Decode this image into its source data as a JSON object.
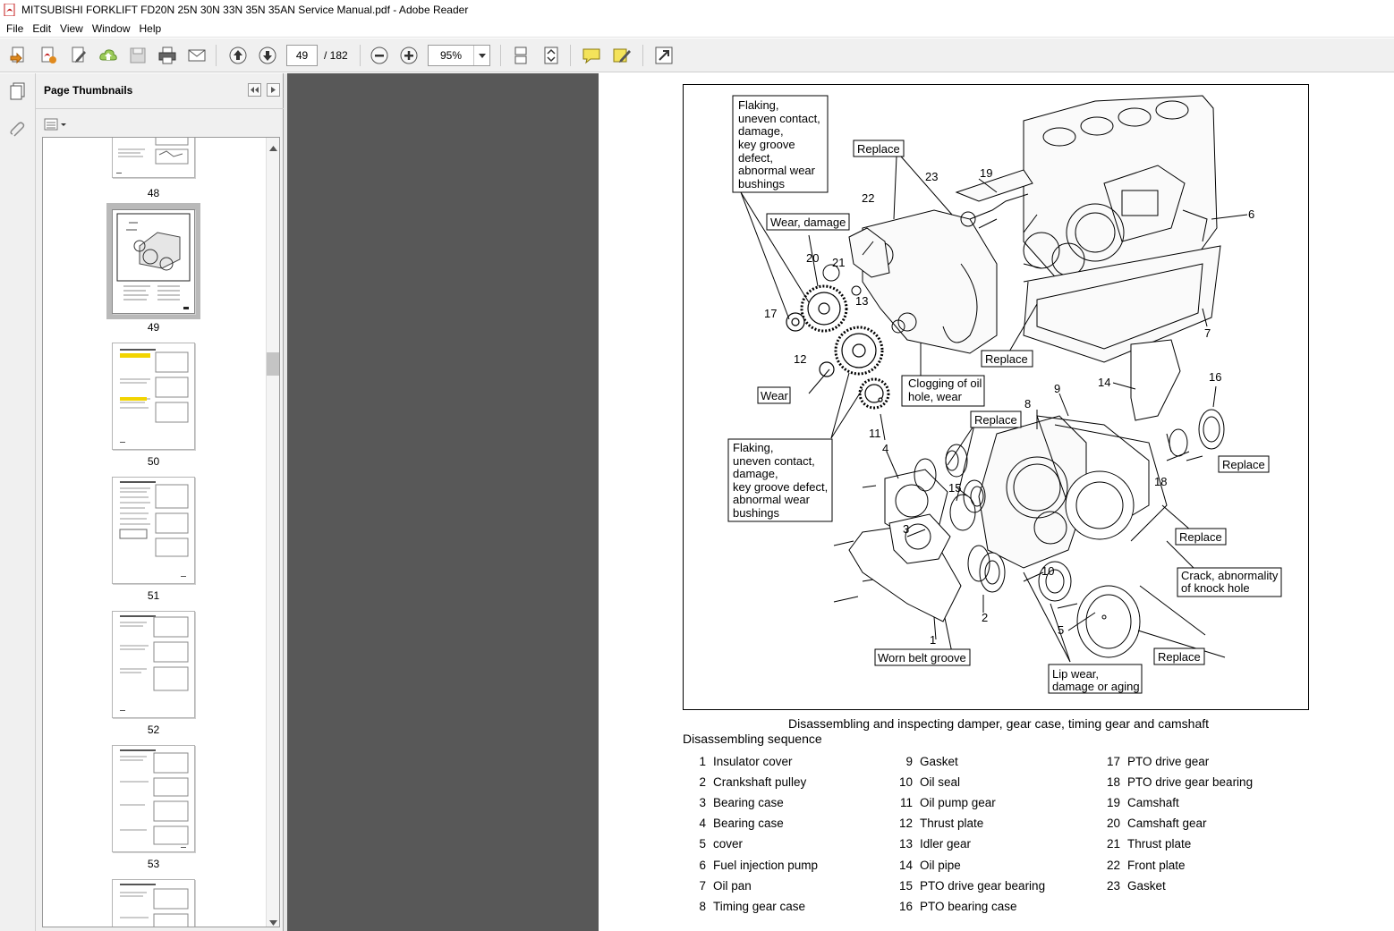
{
  "window": {
    "title": "MITSUBISHI FORKLIFT FD20N 25N 30N 33N 35N 35AN Service Manual.pdf - Adobe Reader"
  },
  "menu": [
    "File",
    "Edit",
    "View",
    "Window",
    "Help"
  ],
  "toolbar": {
    "current_page": "49",
    "page_total": "/ 182",
    "zoom": "95%"
  },
  "navpanel": {
    "title": "Page Thumbnails",
    "thumbnails": [
      "48",
      "49",
      "50",
      "51",
      "52",
      "53"
    ],
    "selected": "49"
  },
  "document": {
    "caption": "Disassembling and inspecting damper, gear case, timing gear and camshaft",
    "sequence_title": "Disassembling sequence",
    "parts": [
      {
        "n": "1",
        "t": "Insulator cover"
      },
      {
        "n": "2",
        "t": "Crankshaft pulley"
      },
      {
        "n": "3",
        "t": "Bearing case"
      },
      {
        "n": "4",
        "t": "Bearing case"
      },
      {
        "n": "5",
        "t": "cover"
      },
      {
        "n": "6",
        "t": "Fuel injection pump"
      },
      {
        "n": "7",
        "t": "Oil pan"
      },
      {
        "n": "8",
        "t": "Timing gear case"
      },
      {
        "n": "9",
        "t": "Gasket"
      },
      {
        "n": "10",
        "t": "Oil seal"
      },
      {
        "n": "11",
        "t": "Oil pump gear"
      },
      {
        "n": "12",
        "t": "Thrust plate"
      },
      {
        "n": "13",
        "t": "Idler gear"
      },
      {
        "n": "14",
        "t": "Oil pipe"
      },
      {
        "n": "15",
        "t": "PTO drive gear bearing"
      },
      {
        "n": "16",
        "t": "PTO bearing case"
      },
      {
        "n": "17",
        "t": "PTO drive gear"
      },
      {
        "n": "18",
        "t": "PTO drive gear bearing"
      },
      {
        "n": "19",
        "t": "Camshaft"
      },
      {
        "n": "20",
        "t": "Camshaft gear"
      },
      {
        "n": "21",
        "t": "Thrust plate"
      },
      {
        "n": "22",
        "t": "Front plate"
      },
      {
        "n": "23",
        "t": "Gasket"
      }
    ],
    "callouts": {
      "flaking1": [
        "Flaking,",
        "uneven contact,",
        "damage,",
        "key groove",
        "defect,",
        "abnormal wear",
        "bushings"
      ],
      "replace_top": "Replace",
      "wear_damage": "Wear, damage",
      "replace_mid": "Replace",
      "clogging": [
        "Clogging of oil",
        "hole, wear"
      ],
      "replace_8": "Replace",
      "wear": "Wear",
      "flaking2": [
        "Flaking,",
        "uneven contact,",
        "damage,",
        "key groove defect,",
        "abnormal wear",
        "bushings"
      ],
      "replace_16": "Replace",
      "replace_r": "Replace",
      "crack": [
        "Crack, abnormality",
        "of knock hole"
      ],
      "replace_5": "Replace",
      "worn_belt": "Worn belt groove",
      "lip_wear": [
        "Lip wear,",
        "damage or aging"
      ]
    },
    "number_labels": [
      "23",
      "19",
      "22",
      "6",
      "20",
      "21",
      "13",
      "17",
      "7",
      "12",
      "14",
      "16",
      "9",
      "8",
      "11",
      "4",
      "15",
      "18",
      "3",
      "10",
      "2",
      "1",
      "5"
    ]
  }
}
